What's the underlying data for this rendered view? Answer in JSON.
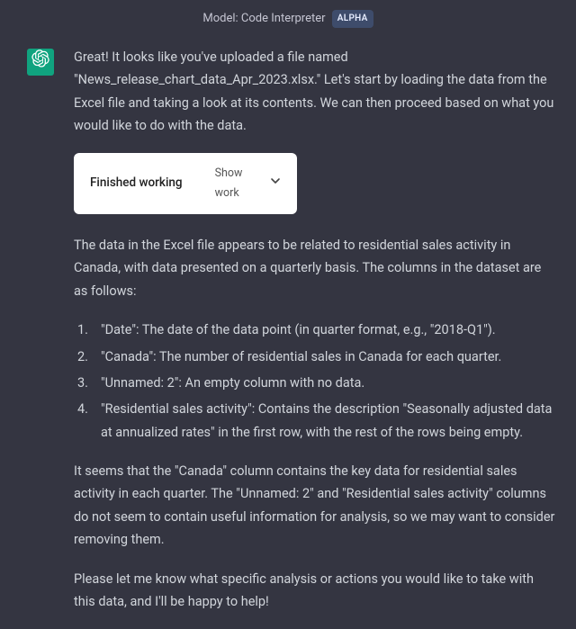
{
  "header": {
    "model_label": "Model: Code Interpreter",
    "badge": "ALPHA"
  },
  "message": {
    "intro": "Great! It looks like you've uploaded a file named \"News_release_chart_data_Apr_2023.xlsx.\" Let's start by loading the data from the Excel file and taking a look at its contents. We can then proceed based on what you would like to do with the data.",
    "work_box": {
      "status": "Finished working",
      "toggle": "Show work"
    },
    "data_desc": "The data in the Excel file appears to be related to residential sales activity in Canada, with data presented on a quarterly basis. The columns in the dataset are as follows:",
    "columns": [
      "\"Date\": The date of the data point (in quarter format, e.g., \"2018-Q1\").",
      "\"Canada\": The number of residential sales in Canada for each quarter.",
      "\"Unnamed: 2\": An empty column with no data.",
      "\"Residential sales activity\": Contains the description \"Seasonally adjusted data at annualized rates\" in the first row, with the rest of the rows being empty."
    ],
    "analysis": "It seems that the \"Canada\" column contains the key data for residential sales activity in each quarter. The \"Unnamed: 2\" and \"Residential sales activity\" columns do not seem to contain useful information for analysis, so we may want to consider removing them.",
    "closing": "Please let me know what specific analysis or actions you would like to take with this data, and I'll be happy to help!"
  }
}
